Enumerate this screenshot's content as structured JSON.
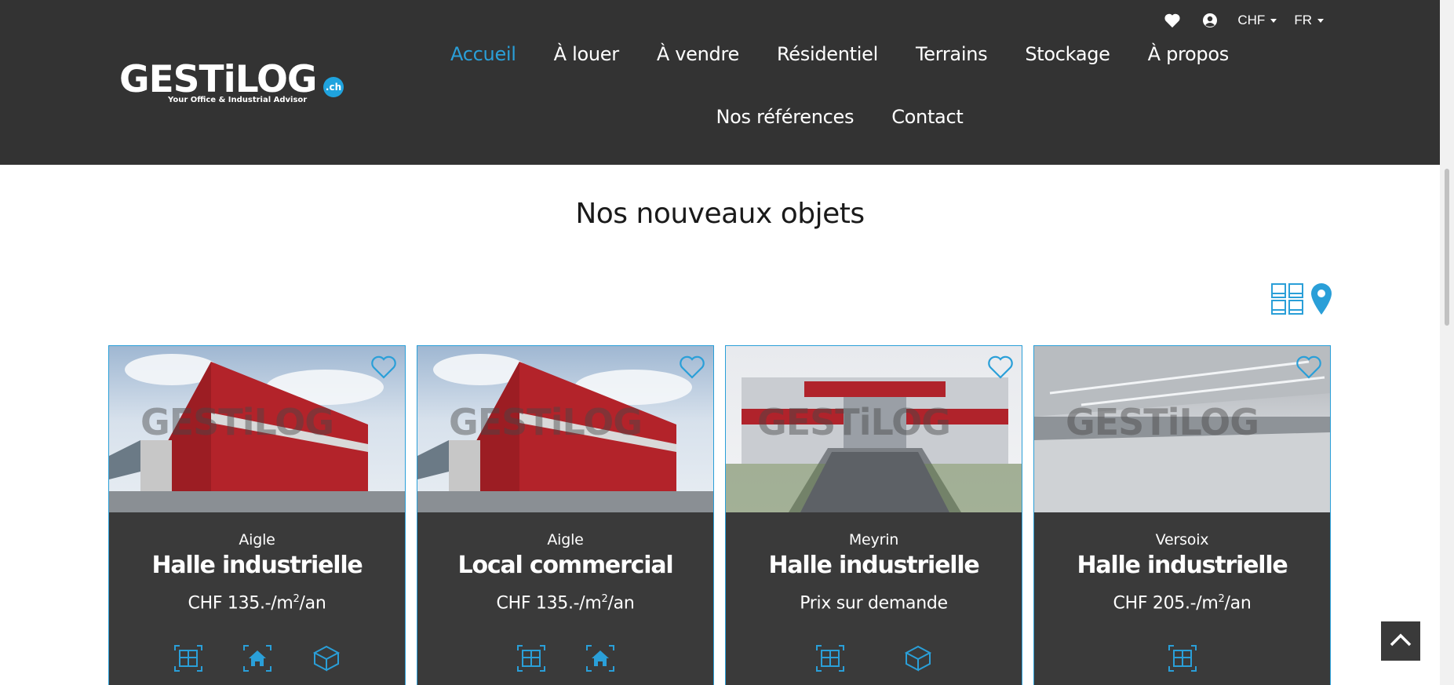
{
  "brand": {
    "name": "GESTiLOG",
    "domain_badge": ".ch",
    "tagline": "Your Office & Industrial Advisor"
  },
  "topbar": {
    "favorites_icon": "heart-icon",
    "account_icon": "user-circle-icon",
    "currency": "CHF",
    "language": "FR"
  },
  "nav": {
    "row1": [
      "Accueil",
      "À louer",
      "À vendre",
      "Résidentiel",
      "Terrains",
      "Stockage",
      "À propos"
    ],
    "row2": [
      "Nos références",
      "Contact"
    ],
    "active": "Accueil"
  },
  "section": {
    "title": "Nos nouveaux objets"
  },
  "view_toggle": {
    "grid_icon": "grid-view-icon",
    "map_icon": "map-pin-icon"
  },
  "colors": {
    "accent": "#2a9fd8",
    "header_bg": "#333333",
    "card_bg": "#3a3a3a"
  },
  "listings": [
    {
      "city": "Aigle",
      "type": "Halle industrielle",
      "price": "CHF 135.-/m",
      "price_sup": "2",
      "price_suffix": "/an",
      "photo": "red-warehouse",
      "features": [
        "floor-plan-icon",
        "home-icon",
        "3d-cube-icon"
      ]
    },
    {
      "city": "Aigle",
      "type": "Local commercial",
      "price": "CHF 135.-/m",
      "price_sup": "2",
      "price_suffix": "/an",
      "photo": "red-warehouse",
      "features": [
        "floor-plan-icon",
        "home-icon"
      ]
    },
    {
      "city": "Meyrin",
      "type": "Halle industrielle",
      "price": "Prix sur demande",
      "price_sup": "",
      "price_suffix": "",
      "photo": "office-building-stairs",
      "features": [
        "floor-plan-icon",
        "3d-cube-icon"
      ]
    },
    {
      "city": "Versoix",
      "type": "Halle industrielle",
      "price": "CHF 205.-/m",
      "price_sup": "2",
      "price_suffix": "/an",
      "photo": "empty-interior",
      "features": [
        "floor-plan-icon"
      ]
    }
  ],
  "back_to_top_icon": "chevron-up-icon"
}
